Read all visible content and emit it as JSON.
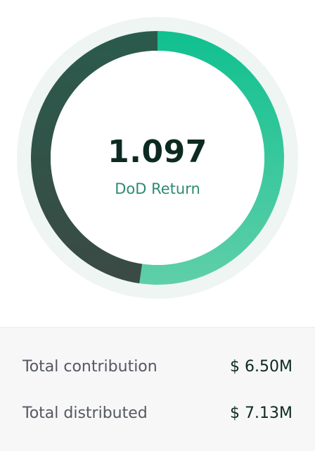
{
  "donut": {
    "value": "1.097",
    "label": "DoD Return",
    "distributed_share": 0.5229,
    "colors": {
      "halo": "#eef5f3",
      "green_start": "#10c08f",
      "green_end": "#5fcfa9",
      "dark_start": "#2a5b4c",
      "dark_end": "#3a4a44",
      "center_value": "#0d2a22",
      "center_label": "#2f8a72"
    }
  },
  "summary": {
    "rows": [
      {
        "label": "Total contribution",
        "value": "$ 6.50M"
      },
      {
        "label": "Total distributed",
        "value": "$ 7.13M"
      }
    ]
  }
}
